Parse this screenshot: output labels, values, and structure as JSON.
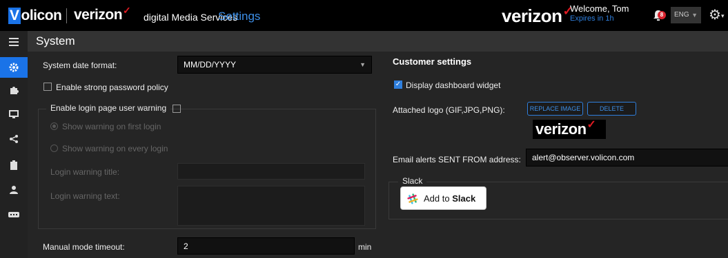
{
  "topbar": {
    "volicon_logo_v": "V",
    "volicon_logo_rest": "olicon",
    "brand": "verizon",
    "brand_check": "✓",
    "product": "digital Media Services",
    "section": "Settings",
    "verizon_logo": "verizon",
    "welcome": "Welcome, Tom",
    "expires": "Expires in 1h",
    "notifications_count": "8",
    "language": "ENG"
  },
  "sidenav": {
    "items": [
      "menu",
      "settings",
      "plugins",
      "monitor",
      "share",
      "clipboard",
      "user",
      "hardware"
    ]
  },
  "header": {
    "title": "System"
  },
  "system": {
    "date_format_label": "System date format:",
    "date_format_value": "MM/DD/YYYY",
    "strong_password_label": "Enable strong password policy",
    "login_warning_label": "Enable login page user warning",
    "show_first_login": "Show warning on first login",
    "show_every_login": "Show warning on every login",
    "warning_title_label": "Login warning title:",
    "warning_text_label": "Login warning text:",
    "manual_timeout_label": "Manual mode timeout:",
    "manual_timeout_value": "2",
    "manual_timeout_unit": "min"
  },
  "customer": {
    "title": "Customer settings",
    "dashboard_widget_label": "Display dashboard widget",
    "dashboard_widget_checked": true,
    "attached_logo_label": "Attached logo (GIF,JPG,PNG):",
    "replace_image": "REPLACE IMAGE",
    "delete": "DELETE",
    "logo_text": "verizon",
    "email_label": "Email alerts SENT FROM address:",
    "email_value": "alert@observer.volicon.com",
    "slack_legend": "Slack",
    "add_to": "Add to",
    "slack_word": "Slack"
  },
  "colors": {
    "accent": "#1a73e8",
    "brand_red": "#e01b22",
    "badge": "#d9232e"
  }
}
